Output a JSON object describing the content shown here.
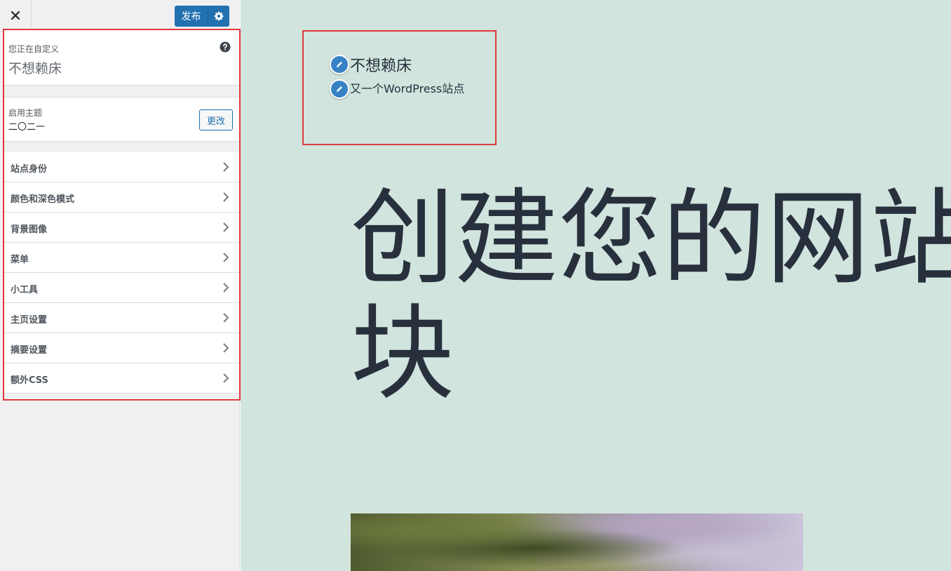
{
  "toolbar": {
    "close_icon": "close-icon",
    "publish_label": "发布",
    "settings_icon": "gear-icon"
  },
  "customizing": {
    "label": "您正在自定义",
    "site_title": "不想赖床",
    "help_icon": "help-icon"
  },
  "theme": {
    "label": "启用主题",
    "name": "二〇二一",
    "change_label": "更改"
  },
  "menu": {
    "items": [
      {
        "label": "站点身份"
      },
      {
        "label": "颜色和深色模式"
      },
      {
        "label": "背景图像"
      },
      {
        "label": "菜单"
      },
      {
        "label": "小工具"
      },
      {
        "label": "主页设置"
      },
      {
        "label": "摘要设置"
      },
      {
        "label": "额外CSS"
      }
    ]
  },
  "preview": {
    "site_title": "不想赖床",
    "tagline": "又一个WordPress站点",
    "hero_text": "创建您的网站块",
    "edit_icon": "pencil-icon"
  },
  "colors": {
    "accent": "#2271b1",
    "preview_bg": "#d1e4dd",
    "highlight_border": "#e0383e",
    "edit_shortcut": "#3582c4"
  }
}
